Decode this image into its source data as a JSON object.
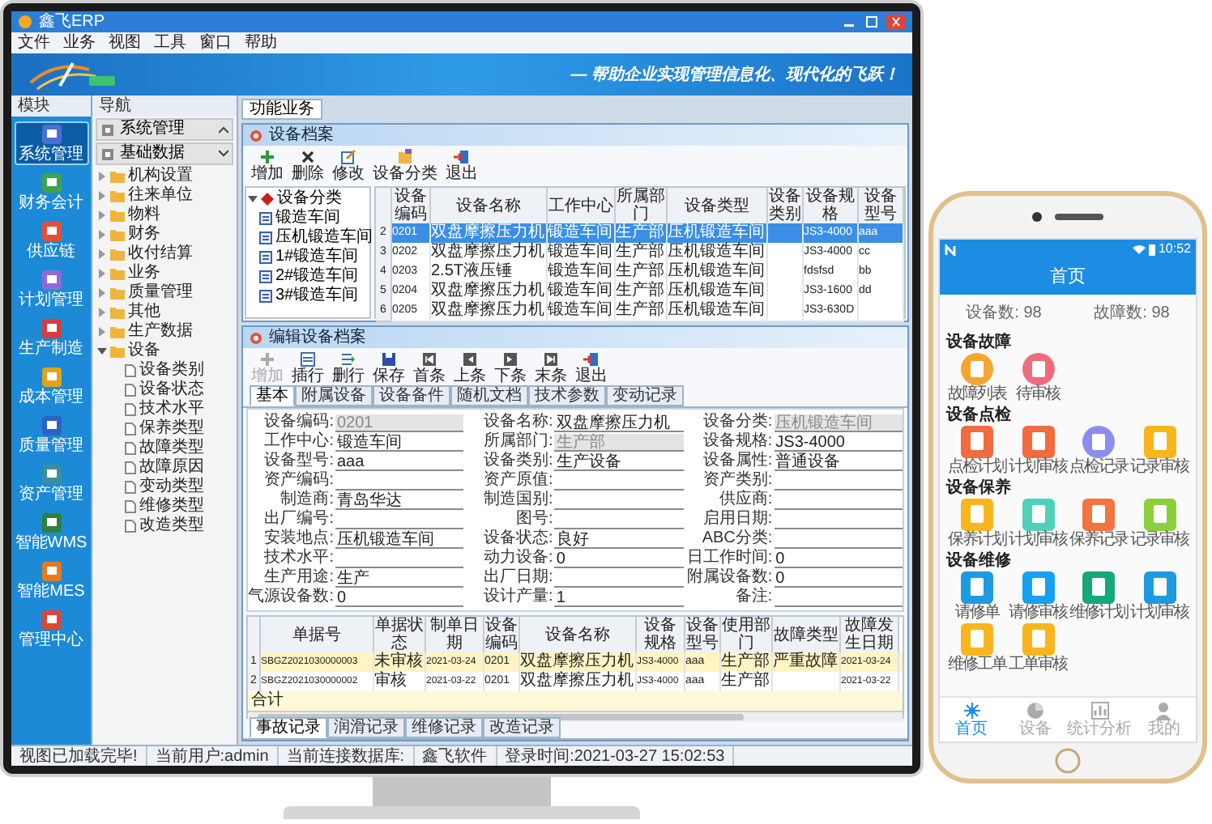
{
  "window": {
    "title": "鑫飞ERP"
  },
  "menu": [
    "文件",
    "业务",
    "视图",
    "工具",
    "窗口",
    "帮助"
  ],
  "banner": {
    "slogan": "— 帮助企业实现管理信息化、现代化的飞跃！"
  },
  "module_panel": {
    "title": "模块",
    "items": [
      {
        "label": "系统管理",
        "selected": true
      },
      {
        "label": "财务会计",
        "selected": false
      },
      {
        "label": "供应链",
        "selected": false
      },
      {
        "label": "计划管理",
        "selected": false
      },
      {
        "label": "生产制造",
        "selected": false
      },
      {
        "label": "成本管理",
        "selected": false
      },
      {
        "label": "质量管理",
        "selected": false
      },
      {
        "label": "资产管理",
        "selected": false
      },
      {
        "label": "智能WMS",
        "selected": false
      },
      {
        "label": "智能MES",
        "selected": false
      },
      {
        "label": "管理中心",
        "selected": false
      }
    ]
  },
  "nav_panel": {
    "title": "导航",
    "groups": [
      {
        "label": "系统管理",
        "expanded": false
      },
      {
        "label": "基础数据",
        "expanded": true
      }
    ],
    "tree": [
      {
        "label": "机构设置",
        "expanded": false
      },
      {
        "label": "往来单位",
        "expanded": false
      },
      {
        "label": "物料",
        "expanded": false
      },
      {
        "label": "财务",
        "expanded": false
      },
      {
        "label": "收付结算",
        "expanded": false
      },
      {
        "label": "业务",
        "expanded": false
      },
      {
        "label": "质量管理",
        "expanded": false
      },
      {
        "label": "其他",
        "expanded": false
      },
      {
        "label": "生产数据",
        "expanded": false
      },
      {
        "label": "设备",
        "expanded": true,
        "children": [
          {
            "label": "设备类别"
          },
          {
            "label": "设备状态"
          },
          {
            "label": "技术水平"
          },
          {
            "label": "保养类型"
          },
          {
            "label": "故障类型"
          },
          {
            "label": "故障原因"
          },
          {
            "label": "变动类型"
          },
          {
            "label": "维修类型"
          },
          {
            "label": "改造类型"
          }
        ]
      }
    ]
  },
  "workspace": {
    "tab": "功能业务"
  },
  "equipment_window": {
    "title": "设备档案",
    "toolbar": [
      "增加",
      "删除",
      "修改",
      "设备分类",
      "退出"
    ],
    "tree": {
      "label": "设备分类",
      "expanded": true,
      "children": [
        {
          "label": "锻造车间"
        },
        {
          "label": "压机锻造车间"
        },
        {
          "label": "1#锻造车间"
        },
        {
          "label": "2#锻造车间"
        },
        {
          "label": "3#锻造车间"
        }
      ]
    },
    "table": {
      "columns": [
        "设备编码",
        "设备名称",
        "工作中心",
        "所属部门",
        "设备类型",
        "设备类别",
        "设备规格",
        "设备型号"
      ],
      "rows": [
        {
          "number": "2",
          "selected": true,
          "cells": [
            "0201",
            "双盘摩擦压力机",
            "锻造车间",
            "生产部",
            "压机锻造车间",
            null,
            "JS3-4000",
            "aaa"
          ]
        },
        {
          "number": "3",
          "selected": false,
          "cells": [
            "0202",
            "双盘摩擦压力机",
            "锻造车间",
            "生产部",
            "压机锻造车间",
            null,
            "JS3-4000",
            "cc"
          ]
        },
        {
          "number": "4",
          "selected": false,
          "cells": [
            "0203",
            "2.5T液压锤",
            "锻造车间",
            "生产部",
            "压机锻造车间",
            null,
            "fdsfsd",
            "bb"
          ]
        },
        {
          "number": "5",
          "selected": false,
          "cells": [
            "0204",
            "双盘摩擦压力机",
            "锻造车间",
            "生产部",
            "压机锻造车间",
            null,
            "JS3-1600",
            "dd"
          ]
        },
        {
          "number": "6",
          "selected": false,
          "cells": [
            "0205",
            "双盘摩擦压力机",
            "锻造车间",
            "生产部",
            "压机锻造车间",
            null,
            "JS3-630D",
            null
          ]
        }
      ]
    }
  },
  "edit_dialog": {
    "title": "编辑设备档案",
    "toolbar": [
      {
        "label": "增加",
        "disabled": true
      },
      {
        "label": "插行",
        "disabled": false
      },
      {
        "label": "删行",
        "disabled": false
      },
      {
        "label": "保存",
        "disabled": false
      },
      {
        "label": "首条",
        "disabled": false
      },
      {
        "label": "上条",
        "disabled": false
      },
      {
        "label": "下条",
        "disabled": false
      },
      {
        "label": "末条",
        "disabled": false
      },
      {
        "label": "退出",
        "disabled": false
      }
    ],
    "tabs": [
      {
        "label": "基本",
        "selected": true
      },
      {
        "label": "附属设备",
        "selected": false
      },
      {
        "label": "设备备件",
        "selected": false
      },
      {
        "label": "随机文档",
        "selected": false
      },
      {
        "label": "技术参数",
        "selected": false
      },
      {
        "label": "变动记录",
        "selected": false
      }
    ],
    "fields": [
      {
        "label": "设备编码:",
        "value": "0201",
        "disabled": true
      },
      {
        "label": "设备名称:",
        "value": "双盘摩擦压力机",
        "disabled": false
      },
      {
        "label": "设备分类:",
        "value": "压机锻造车间",
        "disabled": true
      },
      {
        "label": "工作中心:",
        "value": "锻造车间",
        "disabled": false
      },
      {
        "label": "所属部门:",
        "value": "生产部",
        "disabled": true
      },
      {
        "label": "设备规格:",
        "value": "JS3-4000",
        "disabled": false
      },
      {
        "label": "设备型号:",
        "value": "aaa",
        "disabled": false
      },
      {
        "label": "设备类别:",
        "value": "生产设备",
        "disabled": false
      },
      {
        "label": "设备属性:",
        "value": "普通设备",
        "disabled": false
      },
      {
        "label": "资产编码:",
        "disabled": false
      },
      {
        "label": "资产原值:",
        "disabled": false
      },
      {
        "label": "资产类别:",
        "disabled": false
      },
      {
        "label": "制造商:",
        "value": "青岛华达",
        "disabled": false
      },
      {
        "label": "制造国别:",
        "disabled": false
      },
      {
        "label": "供应商:",
        "disabled": false
      },
      {
        "label": "出厂编号:",
        "disabled": false
      },
      {
        "label": "图号:",
        "disabled": false
      },
      {
        "label": "启用日期:",
        "disabled": false
      },
      {
        "label": "安装地点:",
        "value": "压机锻造车间",
        "disabled": false
      },
      {
        "label": "设备状态:",
        "value": "良好",
        "disabled": false
      },
      {
        "label": "ABC分类:",
        "disabled": false
      },
      {
        "label": "技术水平:",
        "disabled": false
      },
      {
        "label": "动力设备:",
        "value": "0",
        "disabled": false
      },
      {
        "label": "日工作时间:",
        "value": "0",
        "disabled": false
      },
      {
        "label": "生产用途:",
        "value": "生产",
        "disabled": false
      },
      {
        "label": "出厂日期:",
        "disabled": false
      },
      {
        "label": "附属设备数:",
        "value": "0",
        "disabled": false
      },
      {
        "label": "气源设备数:",
        "value": "0",
        "disabled": false
      },
      {
        "label": "设计产量:",
        "value": "1",
        "disabled": false
      },
      {
        "label": "备注:",
        "disabled": false
      }
    ],
    "detail_table": {
      "columns": [
        "单据号",
        "单据状态",
        "制单日期",
        "设备编码",
        "设备名称",
        "设备规格",
        "设备型号",
        "使用部门",
        "故障类型",
        "故障发生日期"
      ],
      "rows": [
        {
          "number": "1",
          "selected": true,
          "cells": [
            "SBGZ2021030000003",
            "未审核",
            "2021-03-24",
            "0201",
            "双盘摩擦压力机",
            "JS3-4000",
            "aaa",
            "生产部",
            "严重故障",
            "2021-03-24"
          ]
        },
        {
          "number": "2",
          "selected": false,
          "cells": [
            "SBGZ2021030000002",
            "审核",
            "2021-03-22",
            "0201",
            "双盘摩擦压力机",
            "JS3-4000",
            "aaa",
            "生产部",
            null,
            "2021-03-22"
          ]
        }
      ],
      "total_label": "合计"
    },
    "bottom_tabs": [
      {
        "label": "事故记录",
        "selected": true
      },
      {
        "label": "润滑记录",
        "selected": false
      },
      {
        "label": "维修记录",
        "selected": false
      },
      {
        "label": "改造记录",
        "selected": false
      }
    ]
  },
  "status_bar": [
    "视图已加载完毕!",
    "当前用户:admin",
    "当前连接数据库:",
    "鑫飞软件",
    "登录时间:2021-03-27 15:02:53"
  ],
  "phone": {
    "status_time": "10:52",
    "title": "首页",
    "stats": [
      "设备数: 98",
      "故障数: 98"
    ],
    "sections": [
      {
        "title": "设备故障",
        "items": [
          {
            "label": "故障列表",
            "kind": "circle",
            "color": "#f7a531"
          },
          {
            "label": "待审核",
            "kind": "circle",
            "color": "#f06b7b"
          }
        ]
      },
      {
        "title": "设备点检",
        "items": [
          {
            "label": "点检计划",
            "kind": "tile",
            "color": "#f26a3d"
          },
          {
            "label": "计划审核",
            "kind": "tile",
            "color": "#f26a3d"
          },
          {
            "label": "点检记录",
            "kind": "circle",
            "color": "#8c8df0"
          },
          {
            "label": "记录审核",
            "kind": "tile",
            "color": "#f9b51c"
          }
        ]
      },
      {
        "title": "设备保养",
        "items": [
          {
            "label": "保养计划",
            "kind": "tile",
            "color": "#f9b51c"
          },
          {
            "label": "计划审核",
            "kind": "tile",
            "color": "#4fd1b9"
          },
          {
            "label": "保养记录",
            "kind": "tile",
            "color": "#f4733f"
          },
          {
            "label": "记录审核",
            "kind": "tile",
            "color": "#8ccf3c"
          }
        ]
      },
      {
        "title": "设备维修",
        "items": [
          {
            "label": "请修单",
            "kind": "tile",
            "color": "#1e9be0"
          },
          {
            "label": "请修审核",
            "kind": "tile",
            "color": "#15a0f0"
          },
          {
            "label": "维修计划",
            "kind": "tile",
            "color": "#14a87a"
          },
          {
            "label": "计划审核",
            "kind": "tile",
            "color": "#1e9be0"
          },
          {
            "label": "维修工单",
            "kind": "tile",
            "color": "#f9b51c"
          },
          {
            "label": "工单审核",
            "kind": "tile",
            "color": "#f9b51c"
          }
        ]
      }
    ],
    "tabbar": [
      {
        "label": "首页",
        "selected": true
      },
      {
        "label": "设备",
        "selected": false
      },
      {
        "label": "统计分析",
        "selected": false
      },
      {
        "label": "我的",
        "selected": false
      }
    ]
  }
}
